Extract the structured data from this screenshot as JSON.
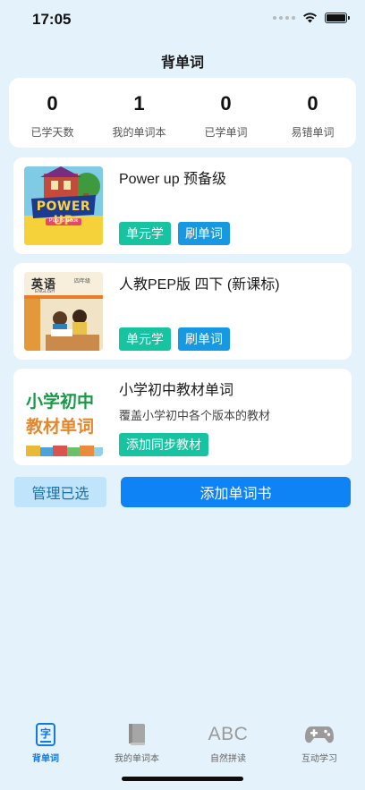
{
  "status": {
    "time": "17:05"
  },
  "nav": {
    "title": "背单词"
  },
  "stats": [
    {
      "value": "0",
      "label": "已学天数"
    },
    {
      "value": "1",
      "label": "我的单词本"
    },
    {
      "value": "0",
      "label": "已学单词"
    },
    {
      "value": "0",
      "label": "易错单词"
    }
  ],
  "books": [
    {
      "title": "Power up 预备级",
      "cover_text": "POWER UP",
      "cover_subtext": "Pupil's Book",
      "buttons": [
        "单元学",
        "刷单词"
      ]
    },
    {
      "title": "人教PEP版 四下 (新课标)",
      "cover_text": "英语",
      "cover_subtext": "ENGLISH",
      "cover_grade": "四年级",
      "buttons": [
        "单元学",
        "刷单词"
      ]
    },
    {
      "title": "小学初中教材单词",
      "subtitle": "覆盖小学初中各个版本的教材",
      "cover_line1": "小学初中",
      "cover_line2": "教材单词",
      "buttons": [
        "添加同步教材"
      ]
    }
  ],
  "actions": {
    "manage": "管理已选",
    "add_book": "添加单词书"
  },
  "tabs": [
    {
      "label": "背单词",
      "icon": "character-card-icon",
      "active": true,
      "icon_text": "字"
    },
    {
      "label": "我的单词本",
      "icon": "notebook-icon",
      "active": false
    },
    {
      "label": "自然拼读",
      "icon": "abc-icon",
      "active": false,
      "icon_text": "ABC"
    },
    {
      "label": "互动学习",
      "icon": "gamepad-icon",
      "active": false
    }
  ],
  "colors": {
    "background": "#e4f2fb",
    "teal": "#16c4a2",
    "blue": "#1699e0",
    "primary": "#0d83f6",
    "active_tab": "#1279e0"
  }
}
